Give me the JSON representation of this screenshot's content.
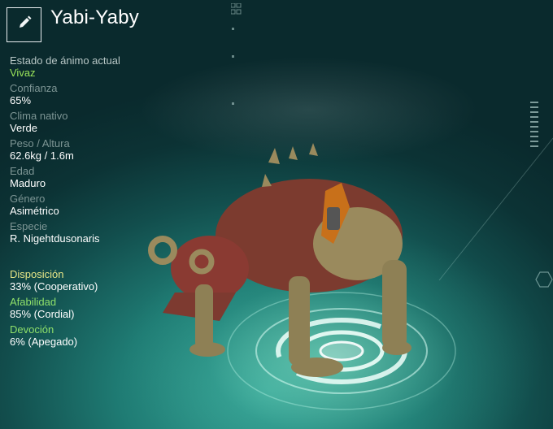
{
  "creature": {
    "name": "Yabi-Yaby",
    "edit_icon": "pencil-icon"
  },
  "stats": [
    {
      "label": "Estado de ánimo actual",
      "value": "Vivaz"
    },
    {
      "label": "Confianza",
      "value": "65%"
    },
    {
      "label": "Clima nativo",
      "value": "Verde"
    },
    {
      "label": "Peso / Altura",
      "value": "62.6kg / 1.6m"
    },
    {
      "label": "Edad",
      "value": "Maduro"
    },
    {
      "label": "Género",
      "value": "Asimétrico"
    },
    {
      "label": "Especie",
      "value": "R. Nigehtdusonaris"
    }
  ],
  "traits": [
    {
      "label": "Disposición",
      "value": "33% (Cooperativo)"
    },
    {
      "label": "Afabilidad",
      "value": "85% (Cordial)"
    },
    {
      "label": "Devoción",
      "value": "6% (Apegado)"
    }
  ],
  "colors": {
    "mood": "#9be55a",
    "disposition": "#e6e687",
    "affability": "#8fe06a",
    "devotion": "#8fe06a"
  }
}
